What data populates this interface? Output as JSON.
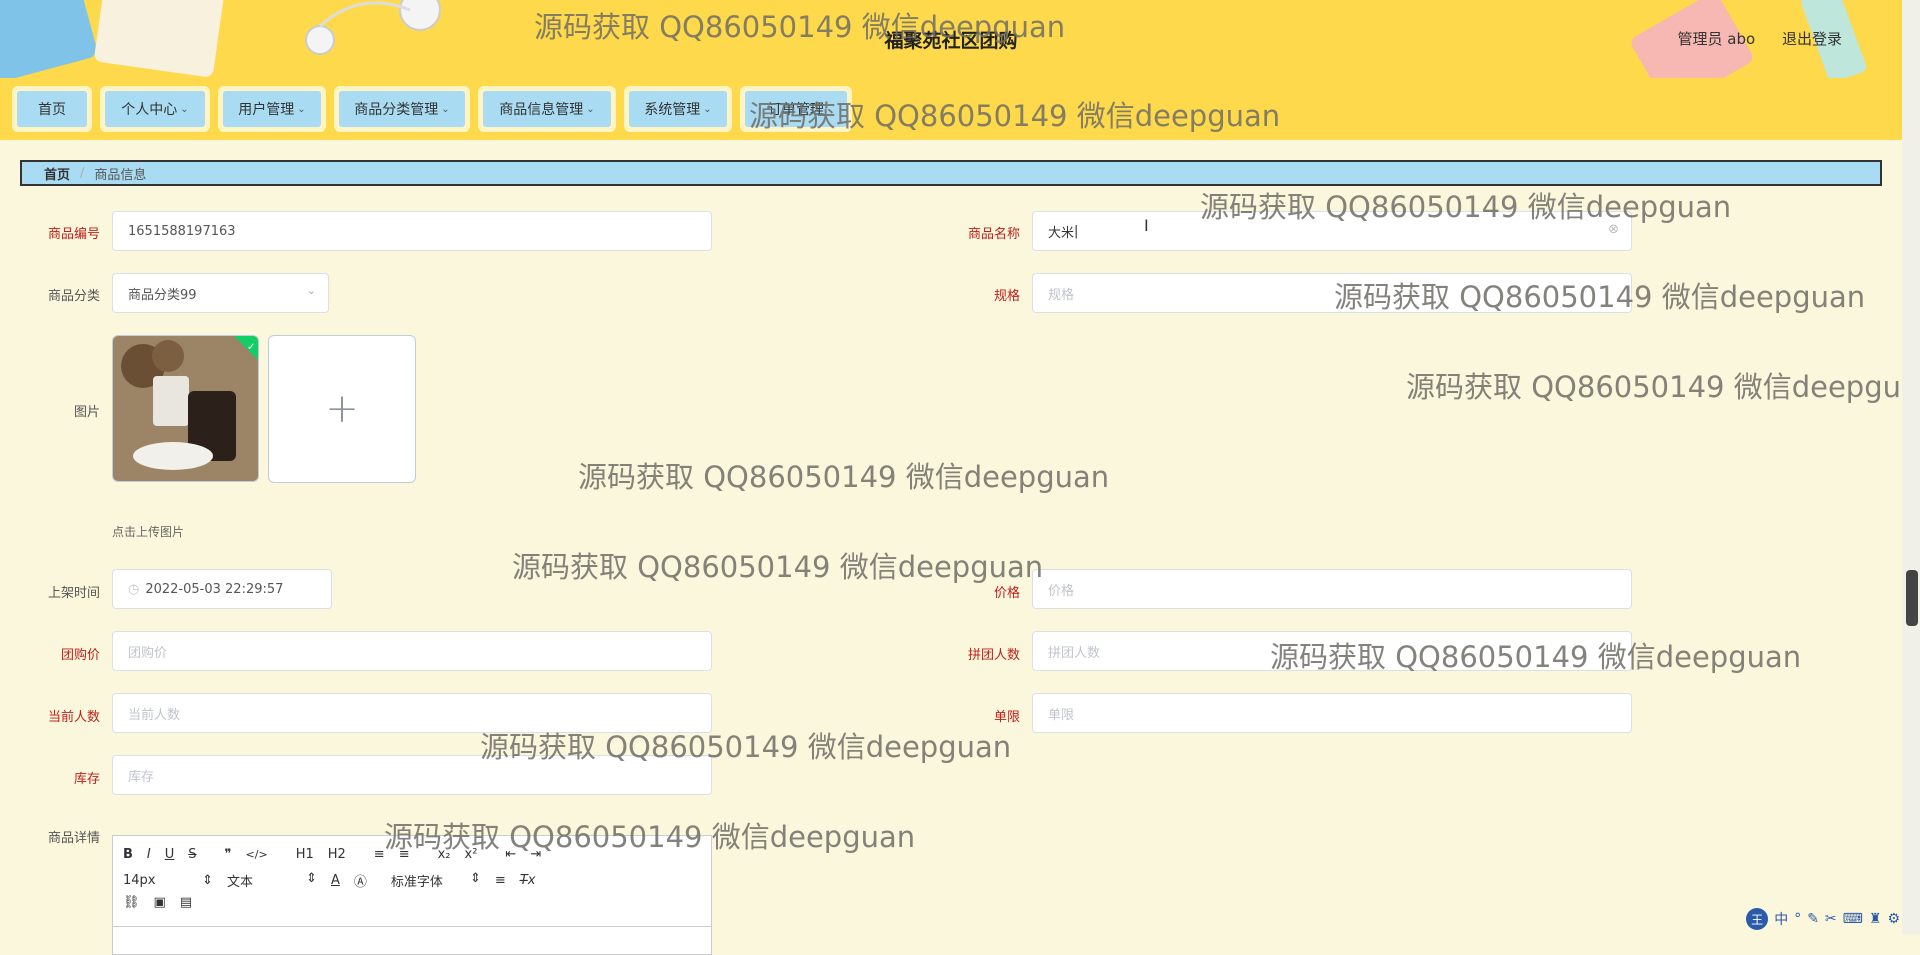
{
  "header": {
    "title": "福聚苑社区团购",
    "admin_label": "管理员 abo",
    "logout_label": "退出登录"
  },
  "nav": {
    "items": [
      {
        "label": "首页",
        "has_dropdown": false
      },
      {
        "label": "个人中心",
        "has_dropdown": true
      },
      {
        "label": "用户管理",
        "has_dropdown": true
      },
      {
        "label": "商品分类管理",
        "has_dropdown": true
      },
      {
        "label": "商品信息管理",
        "has_dropdown": true
      },
      {
        "label": "系统管理",
        "has_dropdown": true
      },
      {
        "label": "订单管理",
        "has_dropdown": false
      }
    ]
  },
  "breadcrumb": {
    "home": "首页",
    "current": "商品信息"
  },
  "form": {
    "code_label": "商品编号",
    "code_value": "1651588197163",
    "name_label": "商品名称",
    "name_value": "大米",
    "category_label": "商品分类",
    "category_value": "商品分类99",
    "spec_label": "规格",
    "spec_placeholder": "规格",
    "image_label": "图片",
    "image_hint": "点击上传图片",
    "time_label": "上架时间",
    "time_value": "2022-05-03 22:29:57",
    "price_label": "价格",
    "price_placeholder": "价格",
    "group_price_label": "团购价",
    "group_price_placeholder": "团购价",
    "group_count_label": "拼团人数",
    "group_count_placeholder": "拼团人数",
    "current_count_label": "当前人数",
    "current_count_placeholder": "当前人数",
    "limit_label": "单限",
    "limit_placeholder": "单限",
    "stock_label": "库存",
    "stock_placeholder": "库存",
    "detail_label": "商品详情"
  },
  "editor": {
    "font_size": "14px",
    "text_type": "文本",
    "font_family": "标准字体",
    "buttons": [
      "B",
      "I",
      "U",
      "S",
      "❞",
      "</>",
      "H1",
      "H2",
      "≡",
      "≡",
      "x₂",
      "x²",
      "⇤",
      "⇥"
    ]
  },
  "watermark": "源码获取 QQ86050149 微信deepguan",
  "ime": {
    "logo": "王",
    "mode": "中"
  },
  "colors": {
    "header_bg": "#fdd94b",
    "nav_item_bg": "#a9dcf3",
    "page_bg": "#fbf7dc",
    "label_red": "#c0201b"
  }
}
